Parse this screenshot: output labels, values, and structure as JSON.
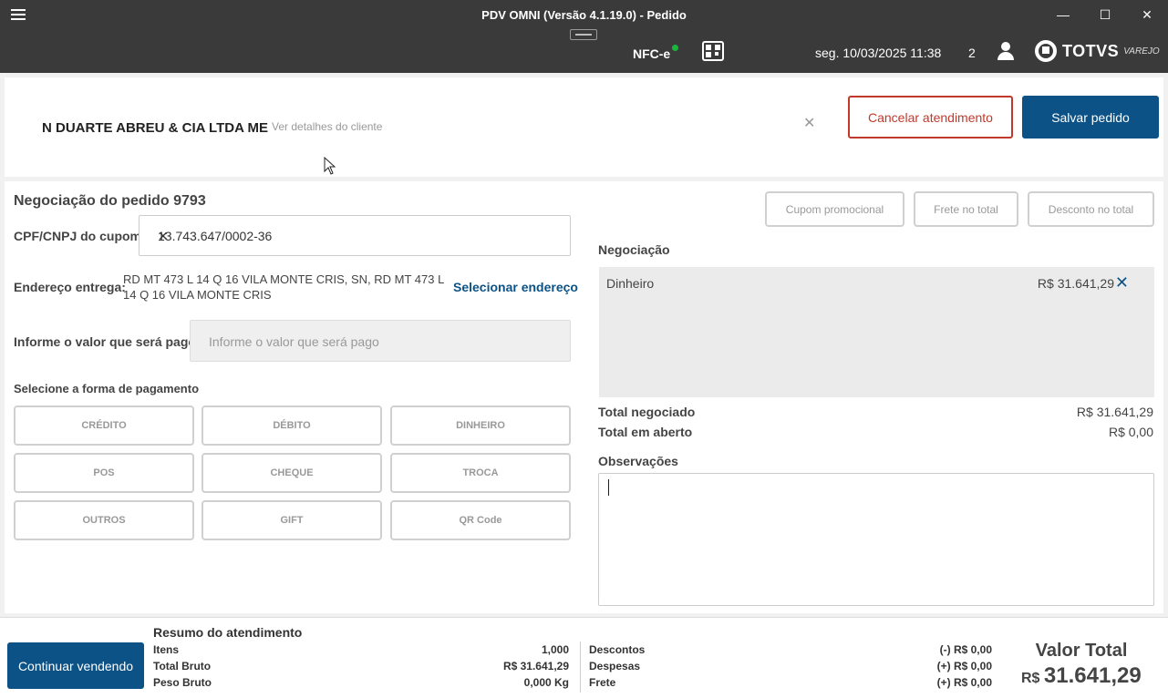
{
  "window": {
    "title": "PDV OMNI (Versão 4.1.19.0) - Pedido",
    "minimize": "—",
    "maximize": "☐",
    "close": "✕"
  },
  "header": {
    "nfce_label": "NFC-e",
    "nfce_status_color": "#19b53a",
    "datetime": "seg. 10/03/2025 11:38",
    "counter": "2",
    "logo_text": "TOTVS",
    "logo_sub": "VAREJO"
  },
  "customer": {
    "name": "N DUARTE ABREU & CIA LTDA ME",
    "details_link": "Ver detalhes do cliente",
    "clear_icon": "✕",
    "cancel_label": "Cancelar atendimento",
    "save_label": "Salvar pedido"
  },
  "order": {
    "title": "Negociação do pedido 9793",
    "doc_label": "CPF/CNPJ do cupom",
    "doc_value": "13.743.647/0002-36",
    "doc_clear": "✕",
    "address_label": "Endereço entrega:",
    "address_text": "RD MT 473 L 14 Q 16 VILA MONTE CRIS, SN, RD MT 473 L 14 Q 16 VILA MONTE CRIS",
    "address_link": "Selecionar endereço",
    "value_label": "Informe o valor que será pago",
    "value_placeholder": "Informe o valor que será pago",
    "payment_title": "Selecione a forma de pagamento",
    "payment_methods": [
      "CRÉDITO",
      "DÉBITO",
      "DINHEIRO",
      "POS",
      "CHEQUE",
      "TROCA",
      "OUTROS",
      "GIFT",
      "QR Code"
    ]
  },
  "negotiation": {
    "buttons": [
      "Cupom promocional",
      "Frete no total",
      "Desconto no total"
    ],
    "title": "Negociação",
    "method": "Dinheiro",
    "amount": "R$ 31.641,29",
    "remove_icon": "✕",
    "total_negotiated_label": "Total negociado",
    "total_negotiated_value": "R$ 31.641,29",
    "total_open_label": "Total em aberto",
    "total_open_value": "R$ 0,00",
    "notes_label": "Observações"
  },
  "footer": {
    "continue_label": "Continuar vendendo",
    "summary_title": "Resumo do atendimento",
    "items_label": "Itens",
    "items_value": "1,000",
    "gross_total_label": "Total Bruto",
    "gross_total_value": "R$ 31.641,29",
    "gross_weight_label": "Peso Bruto",
    "gross_weight_value": "0,000 Kg",
    "discounts_label": "Descontos",
    "discounts_value": "(-) R$ 0,00",
    "expenses_label": "Despesas",
    "expenses_value": "(+) R$ 0,00",
    "freight_label": "Frete",
    "freight_value": "(+) R$ 0,00",
    "total_title": "Valor Total",
    "total_currency": "R$",
    "total_value": "31.641,29"
  }
}
